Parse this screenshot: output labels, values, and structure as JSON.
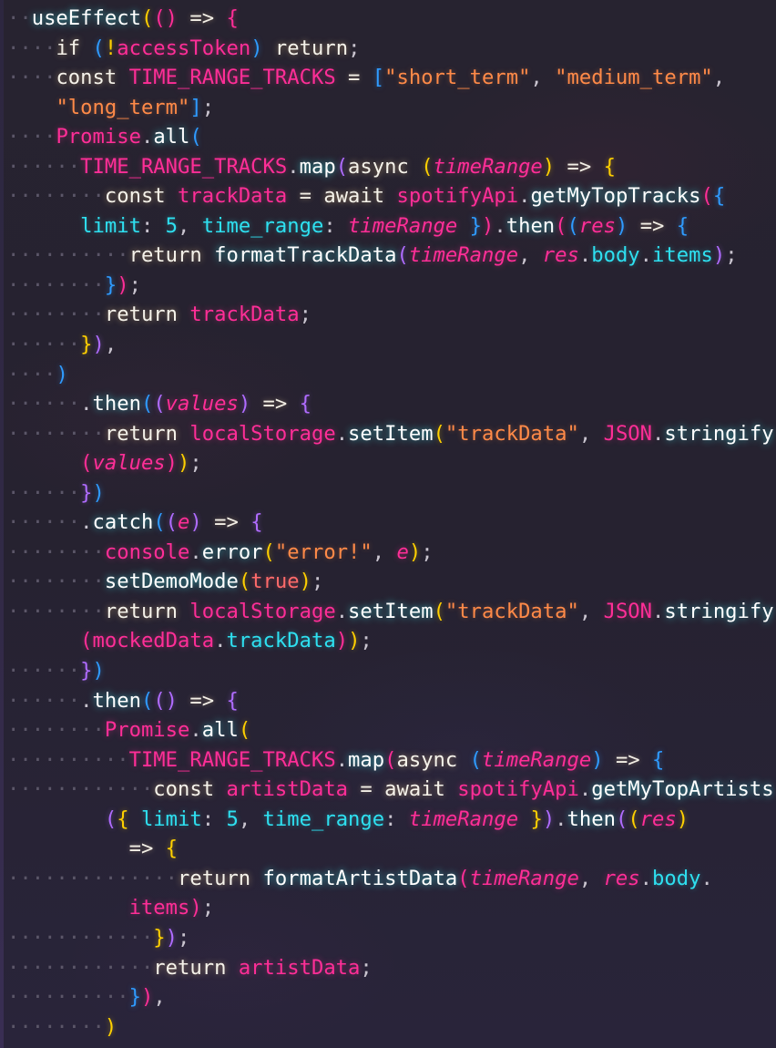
{
  "editor": {
    "language": "javascript",
    "background_color": "#26222f",
    "font_size_px": 22,
    "whitespace_marker": "·",
    "theme_colors": {
      "background": "#26222f",
      "foreground": "#f2f0ee",
      "keyword": "#f5f2ea",
      "function": "#ffffff",
      "variable": "#ff2e97",
      "property": "#2ee0f0",
      "string": "#ff8a48",
      "boolean": "#ff6a6a",
      "punctuation": "#c9c4cf",
      "whitespace_dot": "#5b5668",
      "bracket_1": "#ffd000",
      "bracket_2": "#ff2e97",
      "bracket_3": "#2f9bff",
      "bracket_4": "#b06cff"
    }
  },
  "code": {
    "lines": [
      {
        "n": 1,
        "indent_dots": 2,
        "text": "useEffect(() => {"
      },
      {
        "n": 2,
        "indent_dots": 4,
        "text": "if (!accessToken) return;"
      },
      {
        "n": 3,
        "indent_dots": 4,
        "text": "const TIME_RANGE_TRACKS = [\"short_term\", \"medium_term\","
      },
      {
        "n": 4,
        "indent_dots": 0,
        "text": "\"long_term\"];",
        "wrapped": true
      },
      {
        "n": 5,
        "indent_dots": 4,
        "text": "Promise.all("
      },
      {
        "n": 6,
        "indent_dots": 6,
        "text": "TIME_RANGE_TRACKS.map(async (timeRange) => {"
      },
      {
        "n": 7,
        "indent_dots": 8,
        "text": "const trackData = await spotifyApi.getMyTopTracks({"
      },
      {
        "n": 8,
        "indent_dots": 0,
        "text": "limit: 5, time_range: timeRange }).then((res) => {",
        "wrapped": true
      },
      {
        "n": 9,
        "indent_dots": 10,
        "text": "return formatTrackData(timeRange, res.body.items);"
      },
      {
        "n": 10,
        "indent_dots": 8,
        "text": "});"
      },
      {
        "n": 11,
        "indent_dots": 8,
        "text": "return trackData;"
      },
      {
        "n": 12,
        "indent_dots": 6,
        "text": "}),"
      },
      {
        "n": 13,
        "indent_dots": 4,
        "text": ")"
      },
      {
        "n": 14,
        "indent_dots": 6,
        "text": ".then((values) => {"
      },
      {
        "n": 15,
        "indent_dots": 8,
        "text": "return localStorage.setItem(\"trackData\", JSON.stringify"
      },
      {
        "n": 16,
        "indent_dots": 0,
        "text": "(values));",
        "wrapped": true
      },
      {
        "n": 17,
        "indent_dots": 6,
        "text": "})"
      },
      {
        "n": 18,
        "indent_dots": 6,
        "text": ".catch((e) => {"
      },
      {
        "n": 19,
        "indent_dots": 8,
        "text": "console.error(\"error!\", e);"
      },
      {
        "n": 20,
        "indent_dots": 8,
        "text": "setDemoMode(true);"
      },
      {
        "n": 21,
        "indent_dots": 8,
        "text": "return localStorage.setItem(\"trackData\", JSON.stringify"
      },
      {
        "n": 22,
        "indent_dots": 0,
        "text": "(mockedData.trackData));",
        "wrapped": true
      },
      {
        "n": 23,
        "indent_dots": 6,
        "text": "})"
      },
      {
        "n": 24,
        "indent_dots": 6,
        "text": ".then(() => {"
      },
      {
        "n": 25,
        "indent_dots": 8,
        "text": "Promise.all("
      },
      {
        "n": 26,
        "indent_dots": 10,
        "text": "TIME_RANGE_TRACKS.map(async (timeRange) => {"
      },
      {
        "n": 27,
        "indent_dots": 12,
        "text": "const artistData = await spotifyApi.getMyTopArtists"
      },
      {
        "n": 28,
        "indent_dots": 0,
        "text": "({ limit: 5, time_range: timeRange }).then((res)",
        "wrapped": true
      },
      {
        "n": 29,
        "indent_dots": 0,
        "text": "=> {",
        "wrapped": true
      },
      {
        "n": 30,
        "indent_dots": 14,
        "text": "return formatArtistData(timeRange, res.body."
      },
      {
        "n": 31,
        "indent_dots": 0,
        "text": "items);",
        "wrapped": true
      },
      {
        "n": 32,
        "indent_dots": 12,
        "text": "});"
      },
      {
        "n": 33,
        "indent_dots": 12,
        "text": "return artistData;"
      },
      {
        "n": 34,
        "indent_dots": 10,
        "text": "}),"
      },
      {
        "n": 35,
        "indent_dots": 8,
        "text": ")"
      }
    ],
    "identifiers": {
      "hooks": [
        "useEffect"
      ],
      "variables": [
        "accessToken",
        "TIME_RANGE_TRACKS",
        "trackData",
        "spotifyApi",
        "localStorage",
        "JSON",
        "console",
        "mockedData",
        "artistData",
        "Promise"
      ],
      "parameters": [
        "timeRange",
        "res",
        "values",
        "e"
      ],
      "methods": [
        "all",
        "map",
        "getMyTopTracks",
        "then",
        "formatTrackData",
        "setItem",
        "stringify",
        "catch",
        "error",
        "setDemoMode",
        "getMyTopArtists",
        "formatArtistData"
      ],
      "properties": [
        "limit",
        "time_range",
        "body",
        "items",
        "trackData"
      ],
      "strings": [
        "\"short_term\"",
        "\"medium_term\"",
        "\"long_term\"",
        "\"trackData\"",
        "\"error!\""
      ],
      "numbers": [
        "5"
      ],
      "booleans": [
        "true"
      ],
      "keywords": [
        "if",
        "const",
        "return",
        "await",
        "async"
      ]
    }
  }
}
